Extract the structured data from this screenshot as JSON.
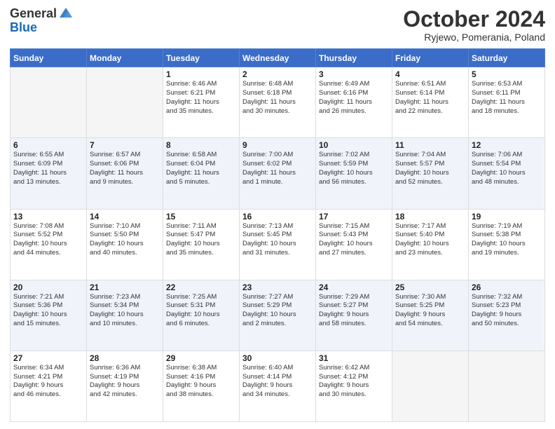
{
  "header": {
    "logo_general": "General",
    "logo_blue": "Blue",
    "month_title": "October 2024",
    "subtitle": "Ryjewo, Pomerania, Poland"
  },
  "days_of_week": [
    "Sunday",
    "Monday",
    "Tuesday",
    "Wednesday",
    "Thursday",
    "Friday",
    "Saturday"
  ],
  "weeks": [
    [
      {
        "day": "",
        "info": ""
      },
      {
        "day": "",
        "info": ""
      },
      {
        "day": "1",
        "info": "Sunrise: 6:46 AM\nSunset: 6:21 PM\nDaylight: 11 hours\nand 35 minutes."
      },
      {
        "day": "2",
        "info": "Sunrise: 6:48 AM\nSunset: 6:18 PM\nDaylight: 11 hours\nand 30 minutes."
      },
      {
        "day": "3",
        "info": "Sunrise: 6:49 AM\nSunset: 6:16 PM\nDaylight: 11 hours\nand 26 minutes."
      },
      {
        "day": "4",
        "info": "Sunrise: 6:51 AM\nSunset: 6:14 PM\nDaylight: 11 hours\nand 22 minutes."
      },
      {
        "day": "5",
        "info": "Sunrise: 6:53 AM\nSunset: 6:11 PM\nDaylight: 11 hours\nand 18 minutes."
      }
    ],
    [
      {
        "day": "6",
        "info": "Sunrise: 6:55 AM\nSunset: 6:09 PM\nDaylight: 11 hours\nand 13 minutes."
      },
      {
        "day": "7",
        "info": "Sunrise: 6:57 AM\nSunset: 6:06 PM\nDaylight: 11 hours\nand 9 minutes."
      },
      {
        "day": "8",
        "info": "Sunrise: 6:58 AM\nSunset: 6:04 PM\nDaylight: 11 hours\nand 5 minutes."
      },
      {
        "day": "9",
        "info": "Sunrise: 7:00 AM\nSunset: 6:02 PM\nDaylight: 11 hours\nand 1 minute."
      },
      {
        "day": "10",
        "info": "Sunrise: 7:02 AM\nSunset: 5:59 PM\nDaylight: 10 hours\nand 56 minutes."
      },
      {
        "day": "11",
        "info": "Sunrise: 7:04 AM\nSunset: 5:57 PM\nDaylight: 10 hours\nand 52 minutes."
      },
      {
        "day": "12",
        "info": "Sunrise: 7:06 AM\nSunset: 5:54 PM\nDaylight: 10 hours\nand 48 minutes."
      }
    ],
    [
      {
        "day": "13",
        "info": "Sunrise: 7:08 AM\nSunset: 5:52 PM\nDaylight: 10 hours\nand 44 minutes."
      },
      {
        "day": "14",
        "info": "Sunrise: 7:10 AM\nSunset: 5:50 PM\nDaylight: 10 hours\nand 40 minutes."
      },
      {
        "day": "15",
        "info": "Sunrise: 7:11 AM\nSunset: 5:47 PM\nDaylight: 10 hours\nand 35 minutes."
      },
      {
        "day": "16",
        "info": "Sunrise: 7:13 AM\nSunset: 5:45 PM\nDaylight: 10 hours\nand 31 minutes."
      },
      {
        "day": "17",
        "info": "Sunrise: 7:15 AM\nSunset: 5:43 PM\nDaylight: 10 hours\nand 27 minutes."
      },
      {
        "day": "18",
        "info": "Sunrise: 7:17 AM\nSunset: 5:40 PM\nDaylight: 10 hours\nand 23 minutes."
      },
      {
        "day": "19",
        "info": "Sunrise: 7:19 AM\nSunset: 5:38 PM\nDaylight: 10 hours\nand 19 minutes."
      }
    ],
    [
      {
        "day": "20",
        "info": "Sunrise: 7:21 AM\nSunset: 5:36 PM\nDaylight: 10 hours\nand 15 minutes."
      },
      {
        "day": "21",
        "info": "Sunrise: 7:23 AM\nSunset: 5:34 PM\nDaylight: 10 hours\nand 10 minutes."
      },
      {
        "day": "22",
        "info": "Sunrise: 7:25 AM\nSunset: 5:31 PM\nDaylight: 10 hours\nand 6 minutes."
      },
      {
        "day": "23",
        "info": "Sunrise: 7:27 AM\nSunset: 5:29 PM\nDaylight: 10 hours\nand 2 minutes."
      },
      {
        "day": "24",
        "info": "Sunrise: 7:29 AM\nSunset: 5:27 PM\nDaylight: 9 hours\nand 58 minutes."
      },
      {
        "day": "25",
        "info": "Sunrise: 7:30 AM\nSunset: 5:25 PM\nDaylight: 9 hours\nand 54 minutes."
      },
      {
        "day": "26",
        "info": "Sunrise: 7:32 AM\nSunset: 5:23 PM\nDaylight: 9 hours\nand 50 minutes."
      }
    ],
    [
      {
        "day": "27",
        "info": "Sunrise: 6:34 AM\nSunset: 4:21 PM\nDaylight: 9 hours\nand 46 minutes."
      },
      {
        "day": "28",
        "info": "Sunrise: 6:36 AM\nSunset: 4:19 PM\nDaylight: 9 hours\nand 42 minutes."
      },
      {
        "day": "29",
        "info": "Sunrise: 6:38 AM\nSunset: 4:16 PM\nDaylight: 9 hours\nand 38 minutes."
      },
      {
        "day": "30",
        "info": "Sunrise: 6:40 AM\nSunset: 4:14 PM\nDaylight: 9 hours\nand 34 minutes."
      },
      {
        "day": "31",
        "info": "Sunrise: 6:42 AM\nSunset: 4:12 PM\nDaylight: 9 hours\nand 30 minutes."
      },
      {
        "day": "",
        "info": ""
      },
      {
        "day": "",
        "info": ""
      }
    ]
  ]
}
